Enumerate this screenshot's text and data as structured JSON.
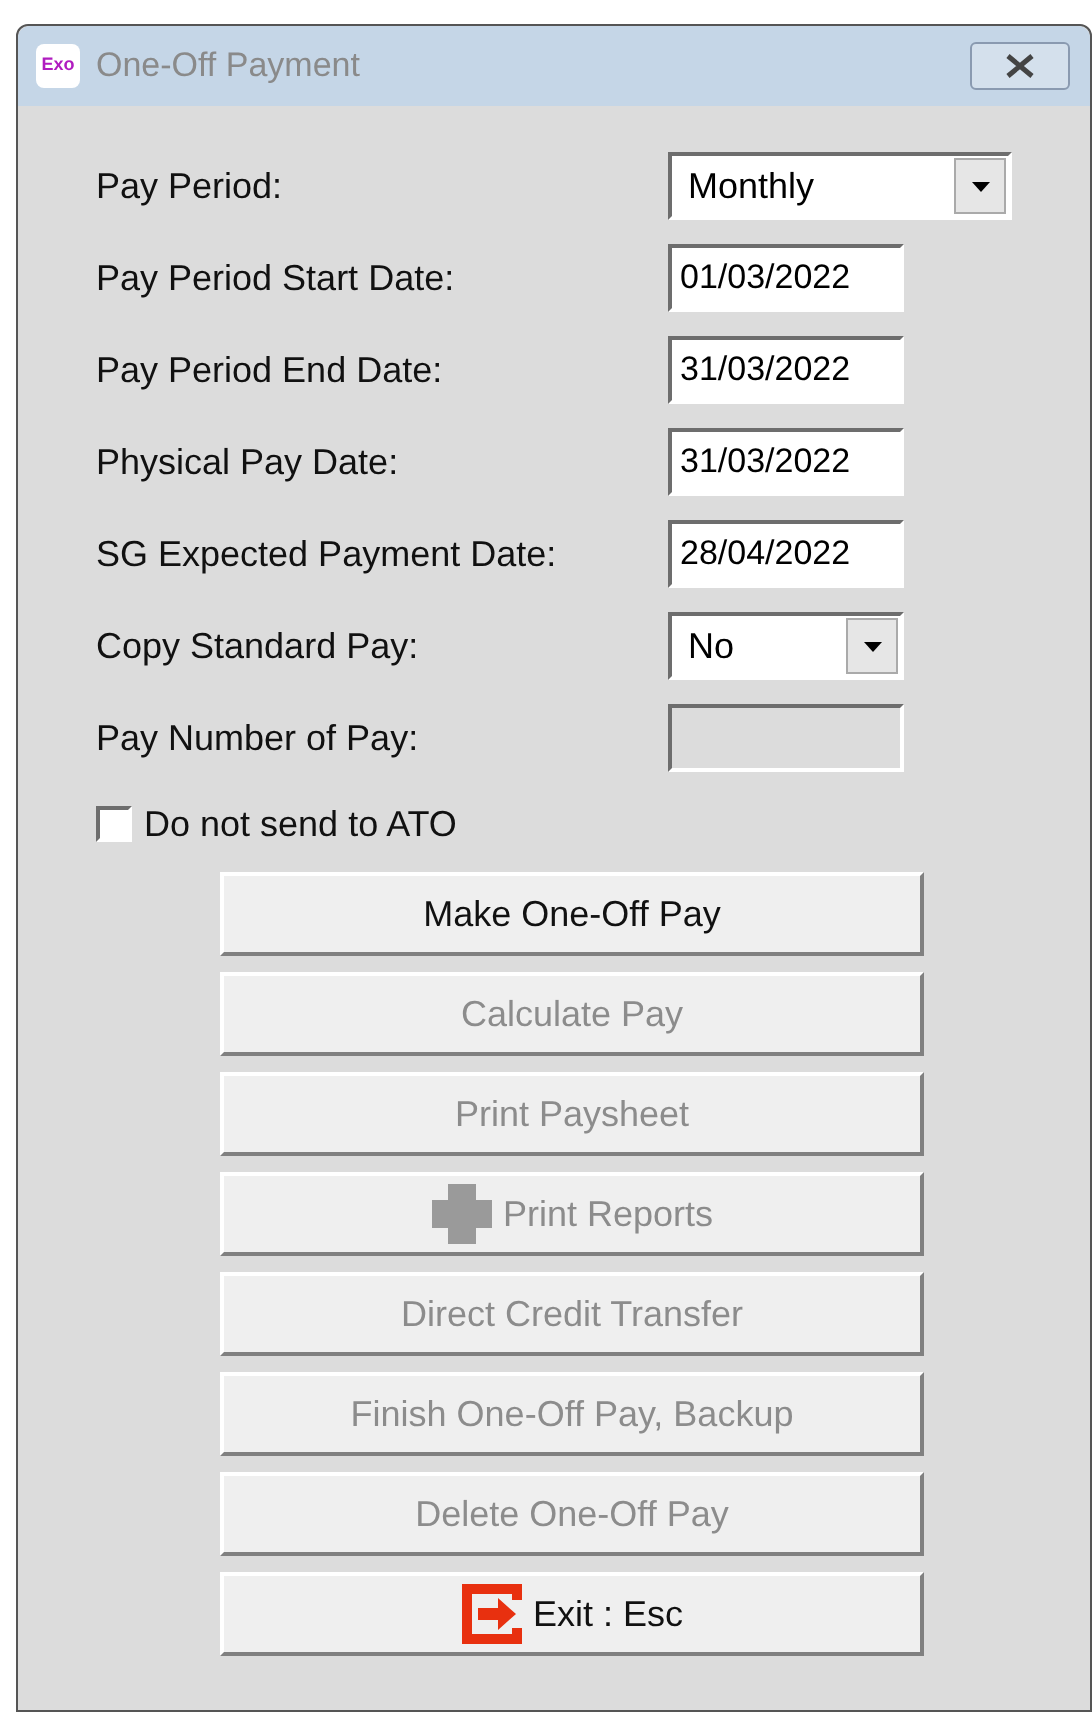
{
  "window": {
    "title": "One-Off Payment",
    "app_icon": "Exo"
  },
  "fields": [
    {
      "label": "Pay Period:",
      "kind": "dropdown",
      "value": "Monthly",
      "wide": true,
      "disabled": false
    },
    {
      "label": "Pay Period Start Date:",
      "kind": "text",
      "value": "01/03/2022",
      "disabled": false
    },
    {
      "label": "Pay Period End Date:",
      "kind": "text",
      "value": "31/03/2022",
      "disabled": false
    },
    {
      "label": "Physical Pay Date:",
      "kind": "text",
      "value": "31/03/2022",
      "disabled": false
    },
    {
      "label": "SG Expected Payment Date:",
      "kind": "text",
      "value": "28/04/2022",
      "disabled": false
    },
    {
      "label": "Copy Standard Pay:",
      "kind": "dropdown",
      "value": "No",
      "wide": false,
      "disabled": false
    },
    {
      "label": "Pay Number of Pay:",
      "kind": "text",
      "disabled": true
    }
  ],
  "checkbox": {
    "label": "Do not send to ATO",
    "checked": false
  },
  "buttons": [
    {
      "label": "Make One-Off Pay",
      "kind": "plain",
      "disabled": false
    },
    {
      "label": "Calculate Pay",
      "kind": "plain",
      "disabled": true
    },
    {
      "label": "Print Paysheet",
      "kind": "plain",
      "disabled": true
    },
    {
      "label": "Print Reports",
      "kind": "print",
      "disabled": true
    },
    {
      "label": "Direct Credit Transfer",
      "kind": "plain",
      "disabled": true
    },
    {
      "label": "Finish One-Off Pay, Backup",
      "kind": "plain",
      "disabled": true
    },
    {
      "label": "Delete One-Off Pay",
      "kind": "plain",
      "disabled": true
    },
    {
      "label": "Exit : Esc",
      "kind": "exit",
      "disabled": false
    }
  ]
}
